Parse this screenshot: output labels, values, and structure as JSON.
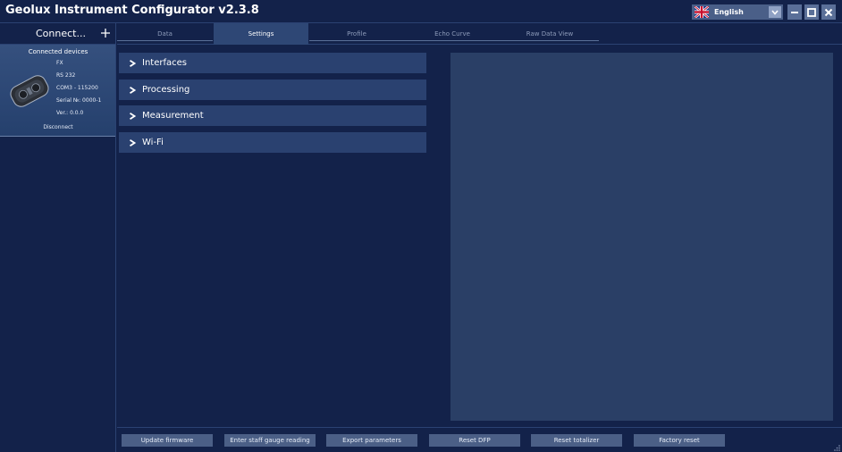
{
  "window": {
    "title": "Geolux Instrument Configurator v2.3.8"
  },
  "language": {
    "selected": "English",
    "flag_icon": "uk-flag-icon"
  },
  "window_controls": [
    "minimize-icon",
    "maximize-icon",
    "close-icon"
  ],
  "sidebar": {
    "connect_label": "Connect...",
    "connected_devices_header": "Connected devices",
    "device": {
      "model": "FX",
      "interface": "RS 232",
      "port": "COM3 - 115200",
      "serial": "Serial №: 0000-1",
      "version": "Ver.: 0.0.0",
      "disconnect_label": "Disconnect"
    }
  },
  "tabs": [
    {
      "label": "Data",
      "active": false
    },
    {
      "label": "Settings",
      "active": true
    },
    {
      "label": "Profile",
      "active": false
    },
    {
      "label": "Echo Curve",
      "active": false
    },
    {
      "label": "Raw Data View",
      "active": false
    }
  ],
  "settings_sections": [
    "Interfaces",
    "Processing",
    "Measurement",
    "Wi-Fi"
  ],
  "actions": {
    "update_firmware": "Update firmware",
    "enter_staff_gauge": "Enter staff gauge reading",
    "export_parameters": "Export parameters",
    "reset_dfp": "Reset DFP",
    "reset_totalizer": "Reset totalizer",
    "factory_reset": "Factory reset"
  },
  "colors": {
    "background": "#13224a",
    "panel": "#2a3f66",
    "section": "#2a4170",
    "button": "#4b5f86",
    "active_tab": "#2e4775"
  }
}
